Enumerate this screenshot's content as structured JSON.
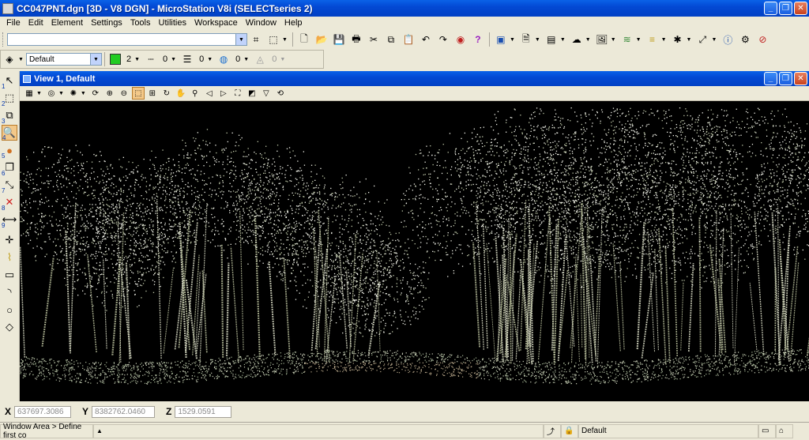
{
  "window": {
    "title": "CC047PNT.dgn [3D - V8 DGN] - MicroStation V8i (SELECTseries 2)"
  },
  "menu": [
    "File",
    "Edit",
    "Element",
    "Settings",
    "Tools",
    "Utilities",
    "Workspace",
    "Window",
    "Help"
  ],
  "attributes": {
    "level": "Default",
    "color_index": "2",
    "line_style": "0",
    "line_weight": "0",
    "class": "0",
    "transparency": "0"
  },
  "view": {
    "title": "View 1, Default"
  },
  "coordinates": {
    "x_label": "X",
    "x_value": "637697.3086",
    "y_label": "Y",
    "y_value": "8382762.0460",
    "z_label": "Z",
    "z_value": "1529.0591"
  },
  "status": {
    "prompt": "Window Area > Define first co",
    "active_level": "Default"
  },
  "icons": [
    "microstation-icon",
    "element-selection-icon",
    "fence-icon",
    "save-icon",
    "print-icon",
    "cut-icon",
    "copy-icon",
    "paste-icon",
    "undo-icon",
    "redo-icon",
    "help-icon",
    "level-display-icon",
    "home-icon",
    "lock-icon"
  ],
  "colors": {
    "accent": "#0349d4",
    "active_color": "#22cc22",
    "canvas": "#000000",
    "points": "#d8dcc4"
  }
}
